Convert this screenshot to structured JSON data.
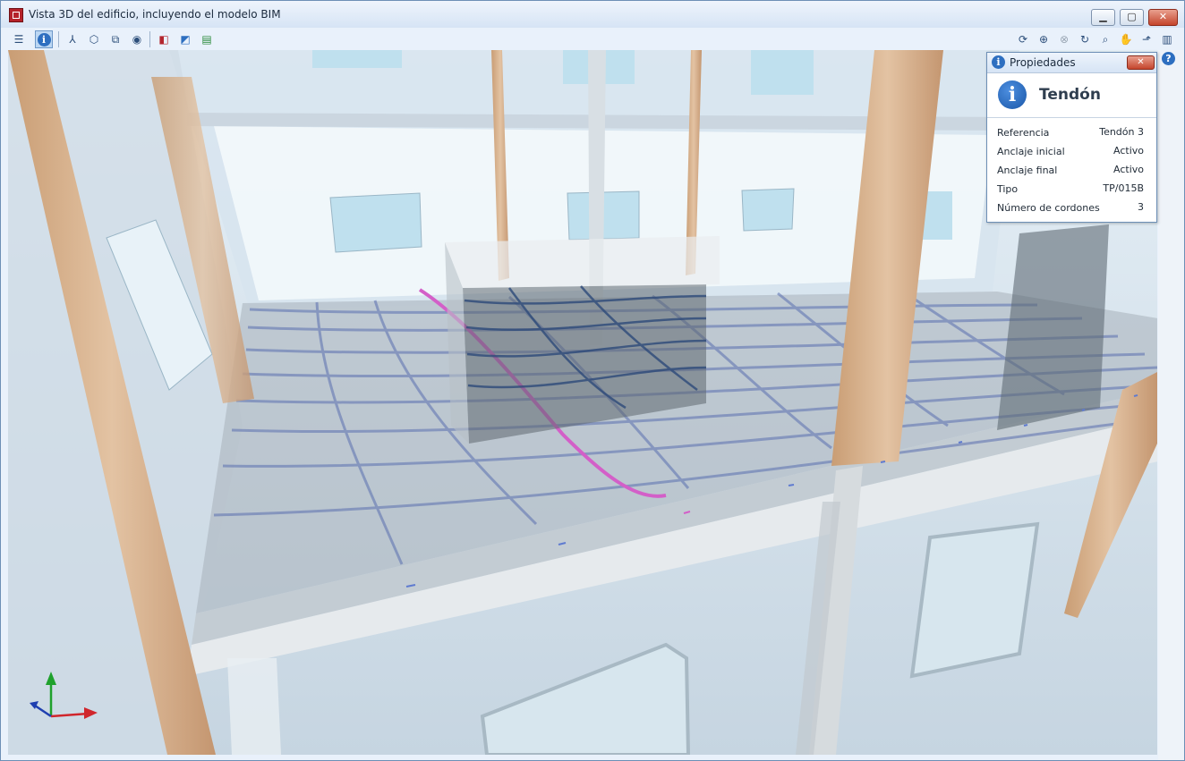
{
  "window": {
    "title": "Vista 3D del edificio, incluyendo el modelo BIM"
  },
  "toolbar": {
    "left_tools": [
      "layers-icon",
      "info-icon",
      "axes-icon",
      "cube-view-icon",
      "views-icon",
      "visibility-icon",
      "section-red-icon",
      "section-blue-icon",
      "section-green-icon"
    ],
    "right_tools": [
      "orbit-icon",
      "zoom-window-icon",
      "zoom-all-icon",
      "refresh-icon",
      "zoom-icon",
      "pan-hand-icon",
      "export-icon",
      "book-icon"
    ]
  },
  "properties": {
    "title": "Propiedades",
    "heading": "Tendón",
    "rows": [
      {
        "key": "Referencia",
        "value": "Tendón 3"
      },
      {
        "key": "Anclaje inicial",
        "value": "Activo"
      },
      {
        "key": "Anclaje final",
        "value": "Activo"
      },
      {
        "key": "Tipo",
        "value": "TP/015B"
      },
      {
        "key": "Número de cordones",
        "value": "3"
      }
    ]
  },
  "colors": {
    "tendon_selected": "#d35fc8",
    "tendon_default": "#5a6fb0",
    "wood": "#d9b48f",
    "glass": "#bfe0ee"
  }
}
